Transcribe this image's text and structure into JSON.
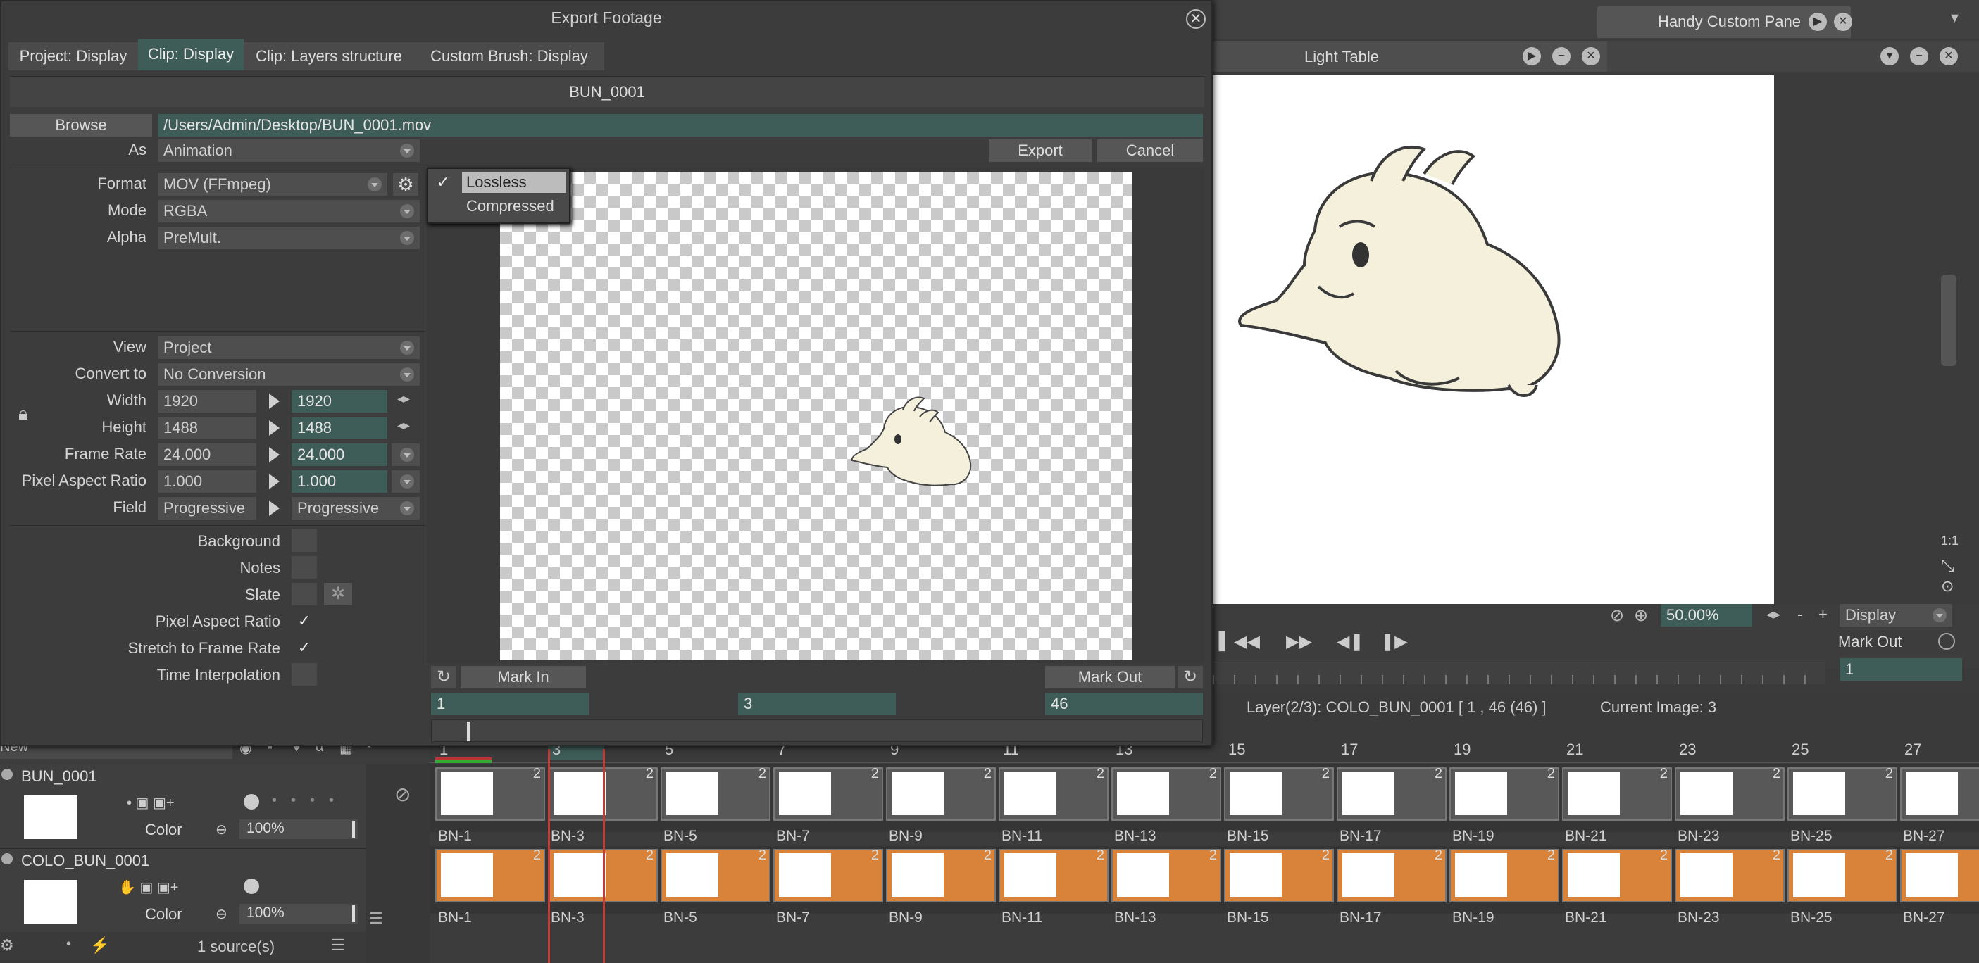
{
  "dialog": {
    "title": "Export Footage",
    "tabs": [
      "Project: Display",
      "Clip: Display",
      "Clip: Layers structure",
      "Custom Brush: Display"
    ],
    "filename": "BUN_0001",
    "browse_label": "Browse",
    "path": "/Users/Admin/Desktop/BUN_0001.mov",
    "as_label": "As",
    "as_value": "Animation",
    "export_label": "Export",
    "cancel_label": "Cancel",
    "format_label": "Format",
    "format_value": "MOV (FFmpeg)",
    "mode_label": "Mode",
    "mode_value": "RGBA",
    "alpha_label": "Alpha",
    "alpha_value": "PreMult.",
    "compression_options": [
      "Lossless",
      "Compressed"
    ],
    "compression_selected": "Lossless",
    "view_label": "View",
    "view_value": "Project",
    "convert_label": "Convert to",
    "convert_value": "No Conversion",
    "width_label": "Width",
    "width_src": "1920",
    "width_dst": "1920",
    "height_label": "Height",
    "height_src": "1488",
    "height_dst": "1488",
    "framerate_label": "Frame Rate",
    "framerate_src": "24.000",
    "framerate_dst": "24.000",
    "par_label": "Pixel Aspect Ratio",
    "par_src": "1.000",
    "par_dst": "1.000",
    "field_label": "Field",
    "field_src": "Progressive",
    "field_dst": "Progressive",
    "background_label": "Background",
    "notes_label": "Notes",
    "slate_label": "Slate",
    "chk_par_label": "Pixel Aspect Ratio",
    "chk_stretch_label": "Stretch to Frame Rate",
    "chk_interp_label": "Time Interpolation",
    "mark_in_label": "Mark In",
    "mark_out_label": "Mark Out",
    "mark_in_value": "1",
    "mark_cur_value": "3",
    "mark_out_value": "46"
  },
  "top": {
    "handy_label": "Handy Custom Pane",
    "lighttable_label": "Light Table"
  },
  "viewer": {
    "zoom": "50.00%",
    "zoom_minus": "-",
    "zoom_plus": "+",
    "display_label": "Display",
    "mark_out_label": "Mark Out",
    "frame_value": "1",
    "ratio_label": "1:1"
  },
  "status": {
    "layer_info": "Layer(2/3): COLO_BUN_0001 [ 1 , 46  (46) ]",
    "current_image": "Current Image: 3"
  },
  "timeline": {
    "new_label": "New",
    "frame_numbers": [
      "1",
      "3",
      "5",
      "7",
      "9",
      "11",
      "13",
      "15",
      "17",
      "19",
      "21",
      "23",
      "25",
      "27"
    ],
    "cell_names": [
      "BN-1",
      "BN-3",
      "BN-5",
      "BN-7",
      "BN-9",
      "BN-11",
      "BN-13",
      "BN-15",
      "BN-17",
      "BN-19",
      "BN-21",
      "BN-23",
      "BN-25",
      "BN-27"
    ],
    "hold": "2",
    "layers": [
      {
        "name": "BUN_0001",
        "color_label": "Color",
        "opacity": "100%"
      },
      {
        "name": "COLO_BUN_0001",
        "color_label": "Color",
        "opacity": "100%"
      }
    ],
    "sources": "1 source(s)"
  },
  "colors": {
    "accent_teal": "#3f5d58",
    "cell_orange": "#d9833a",
    "playhead": "#c83a3a"
  }
}
